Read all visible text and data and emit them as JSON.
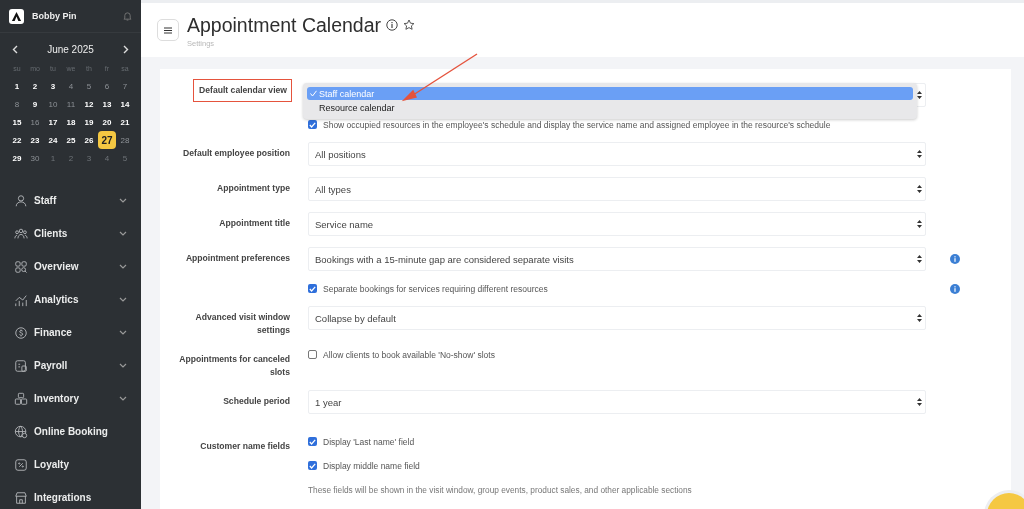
{
  "sidebar": {
    "brand": "Bobby Pin",
    "calendar": {
      "month": "June 2025",
      "weekdays": [
        "su",
        "mo",
        "tu",
        "we",
        "th",
        "fr",
        "sa"
      ],
      "days": [
        {
          "label": "1",
          "kind": "open",
          "selected": false
        },
        {
          "label": "2",
          "kind": "open",
          "selected": false
        },
        {
          "label": "3",
          "kind": "open",
          "selected": false
        },
        {
          "label": "4",
          "kind": "closed",
          "selected": false
        },
        {
          "label": "5",
          "kind": "closed",
          "selected": false
        },
        {
          "label": "6",
          "kind": "closed",
          "selected": false
        },
        {
          "label": "7",
          "kind": "closed",
          "selected": false
        },
        {
          "label": "8",
          "kind": "closed",
          "selected": false
        },
        {
          "label": "9",
          "kind": "open",
          "selected": false
        },
        {
          "label": "10",
          "kind": "closed",
          "selected": false
        },
        {
          "label": "11",
          "kind": "closed",
          "selected": false
        },
        {
          "label": "12",
          "kind": "open",
          "selected": false
        },
        {
          "label": "13",
          "kind": "open",
          "selected": false
        },
        {
          "label": "14",
          "kind": "open",
          "selected": false
        },
        {
          "label": "15",
          "kind": "open",
          "selected": false
        },
        {
          "label": "16",
          "kind": "closed",
          "selected": false
        },
        {
          "label": "17",
          "kind": "open",
          "selected": false
        },
        {
          "label": "18",
          "kind": "open",
          "selected": false
        },
        {
          "label": "19",
          "kind": "open",
          "selected": false
        },
        {
          "label": "20",
          "kind": "open",
          "selected": false
        },
        {
          "label": "21",
          "kind": "open",
          "selected": false
        },
        {
          "label": "22",
          "kind": "open",
          "selected": false
        },
        {
          "label": "23",
          "kind": "open",
          "selected": false
        },
        {
          "label": "24",
          "kind": "open",
          "selected": false
        },
        {
          "label": "25",
          "kind": "open",
          "selected": false
        },
        {
          "label": "26",
          "kind": "open",
          "selected": false
        },
        {
          "label": "27",
          "kind": "open",
          "selected": true
        },
        {
          "label": "28",
          "kind": "closed",
          "selected": false
        },
        {
          "label": "29",
          "kind": "open",
          "selected": false
        },
        {
          "label": "30",
          "kind": "closed",
          "selected": false
        },
        {
          "label": "1",
          "kind": "outside",
          "selected": false
        },
        {
          "label": "2",
          "kind": "outside",
          "selected": false
        },
        {
          "label": "3",
          "kind": "outside",
          "selected": false
        },
        {
          "label": "4",
          "kind": "outside",
          "selected": false
        },
        {
          "label": "5",
          "kind": "outside",
          "selected": false
        }
      ]
    },
    "items": [
      {
        "label": "Staff",
        "expandable": true
      },
      {
        "label": "Clients",
        "expandable": true
      },
      {
        "label": "Overview",
        "expandable": true
      },
      {
        "label": "Analytics",
        "expandable": true
      },
      {
        "label": "Finance",
        "expandable": true
      },
      {
        "label": "Payroll",
        "expandable": true
      },
      {
        "label": "Inventory",
        "expandable": true
      },
      {
        "label": "Online Booking",
        "expandable": false
      },
      {
        "label": "Loyalty",
        "expandable": false
      },
      {
        "label": "Integrations",
        "expandable": false
      }
    ]
  },
  "header": {
    "title": "Appointment Calendar",
    "subtitle": "Settings"
  },
  "form": {
    "rows": [
      {
        "label": "Default calendar view",
        "highlighted": true,
        "controls": [
          {
            "kind": "select",
            "info": false,
            "open": true,
            "options": [
              {
                "label": "Staff calendar",
                "selected": true
              },
              {
                "label": "Resource calendar",
                "selected": false
              }
            ]
          },
          {
            "kind": "checkbox",
            "label": "Show occupied resources in the employee's schedule and display the service name and assigned employee in the resource's schedule",
            "checked": true,
            "info": false
          }
        ]
      },
      {
        "label": "Default employee position",
        "highlighted": false,
        "controls": [
          {
            "kind": "select",
            "value": "All positions",
            "info": false,
            "open": false
          }
        ]
      },
      {
        "label": "Appointment type",
        "highlighted": false,
        "controls": [
          {
            "kind": "select",
            "value": "All types",
            "info": false,
            "open": false
          }
        ]
      },
      {
        "label": "Appointment title",
        "highlighted": false,
        "controls": [
          {
            "kind": "select",
            "value": "Service name",
            "info": false,
            "open": false
          }
        ]
      },
      {
        "label": "Appointment preferences",
        "highlighted": false,
        "controls": [
          {
            "kind": "select",
            "value": "Bookings with a 15-minute gap are considered separate visits",
            "info": true,
            "open": false
          },
          {
            "kind": "checkbox",
            "label": "Separate bookings for services requiring different resources",
            "checked": true,
            "info": true
          }
        ]
      },
      {
        "label": "Advanced visit window settings",
        "highlighted": false,
        "controls": [
          {
            "kind": "select",
            "value": "Collapse by default",
            "info": false,
            "open": false
          }
        ]
      },
      {
        "label": "Appointments for canceled slots",
        "highlighted": false,
        "controls": [
          {
            "kind": "checkbox",
            "label": "Allow clients to book available 'No-show' slots",
            "checked": false,
            "info": false
          }
        ]
      },
      {
        "label": "Schedule period",
        "highlighted": false,
        "controls": [
          {
            "kind": "select",
            "value": "1 year",
            "info": false,
            "open": false
          }
        ]
      },
      {
        "label": "Customer name fields",
        "highlighted": false,
        "controls": [
          {
            "kind": "checkbox",
            "label": "Display 'Last name' field",
            "checked": true,
            "info": false
          },
          {
            "kind": "checkbox",
            "label": "Display middle name field",
            "checked": true,
            "info": false
          },
          {
            "kind": "note",
            "text": "These fields will be shown in the visit window, group events, product sales, and other applicable sections"
          }
        ]
      }
    ]
  }
}
